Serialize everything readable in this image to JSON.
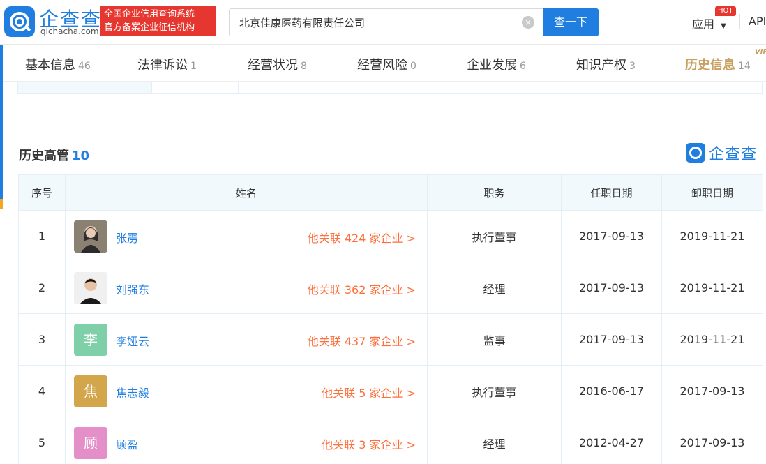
{
  "header": {
    "brand_name": "企查查",
    "brand_domain": "qichacha.com",
    "slogan_line1": "全国企业信用查询系统",
    "slogan_line2": "官方备案企业征信机构",
    "search_value": "北京佳康医药有限责任公司",
    "search_button": "查一下",
    "clear_icon": "×",
    "app_label": "应用",
    "hot_badge": "HOT",
    "api_label": "API"
  },
  "tabs": [
    {
      "label": "基本信息",
      "count": "46"
    },
    {
      "label": "法律诉讼",
      "count": "1"
    },
    {
      "label": "经营状况",
      "count": "8"
    },
    {
      "label": "经营风险",
      "count": "0"
    },
    {
      "label": "企业发展",
      "count": "6"
    },
    {
      "label": "知识产权",
      "count": "3"
    },
    {
      "label": "历史信息",
      "count": "14"
    }
  ],
  "vip_badge": "VIP",
  "section": {
    "title": "历史高管",
    "count": "10",
    "watermark": "企查查"
  },
  "table": {
    "headers": [
      "序号",
      "姓名",
      "职务",
      "任职日期",
      "卸职日期"
    ],
    "rows": [
      {
        "index": "1",
        "name": "张雳",
        "avatar_text": "",
        "avatar_color": "#6b6b6b",
        "relation": "他关联 424 家企业 >",
        "position": "执行董事",
        "start": "2017-09-13",
        "end": "2019-11-21"
      },
      {
        "index": "2",
        "name": "刘强东",
        "avatar_text": "",
        "avatar_color": "#ededed",
        "relation": "他关联 362 家企业 >",
        "position": "经理",
        "start": "2017-09-13",
        "end": "2019-11-21"
      },
      {
        "index": "3",
        "name": "李娅云",
        "avatar_text": "李",
        "avatar_color": "#7fcfa9",
        "relation": "他关联 437 家企业 >",
        "position": "监事",
        "start": "2017-09-13",
        "end": "2019-11-21"
      },
      {
        "index": "4",
        "name": "焦志毅",
        "avatar_text": "焦",
        "avatar_color": "#d4a64c",
        "relation": "他关联 5 家企业 >",
        "position": "执行董事",
        "start": "2016-06-17",
        "end": "2017-09-13"
      },
      {
        "index": "5",
        "name": "顾盈",
        "avatar_text": "顾",
        "avatar_color": "#e58fc8",
        "relation": "他关联 3 家企业 >",
        "position": "经理",
        "start": "2012-04-27",
        "end": "2017-09-13"
      }
    ]
  }
}
